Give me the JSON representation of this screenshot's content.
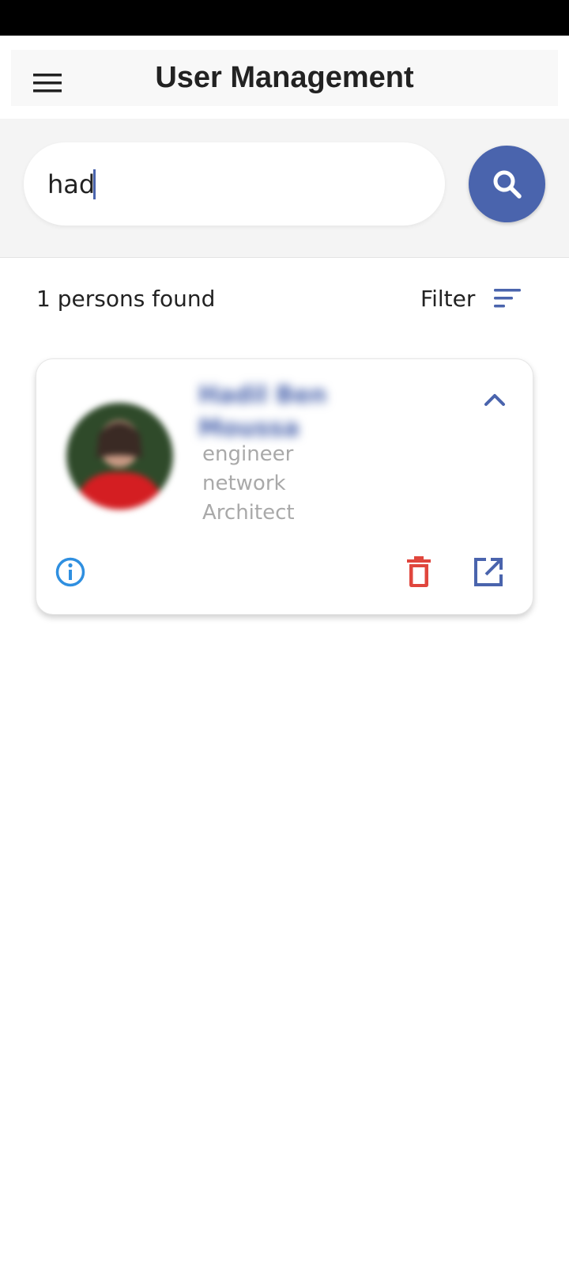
{
  "app_bar": {
    "title": "User Management",
    "menu_icon": "hamburger-menu-icon"
  },
  "search": {
    "value": "had",
    "button_icon": "search-icon"
  },
  "results": {
    "count_text": "1 persons found",
    "filter_label": "Filter",
    "filter_icon": "sort-lines-icon"
  },
  "persons": [
    {
      "name": "Hadil Ben Moussa",
      "role_lines": [
        "engineer",
        "network",
        "Architect"
      ],
      "avatar": "person-photo",
      "actions": [
        "info-icon",
        "trash-icon",
        "open-external-icon"
      ]
    }
  ],
  "colors": {
    "primary": "#4a64ad",
    "danger": "#e0463d",
    "info": "#2f8fe0",
    "muted_text": "#a9a9a9",
    "app_bar_bg": "#f8f8f8",
    "search_band_bg": "#f4f4f4"
  }
}
